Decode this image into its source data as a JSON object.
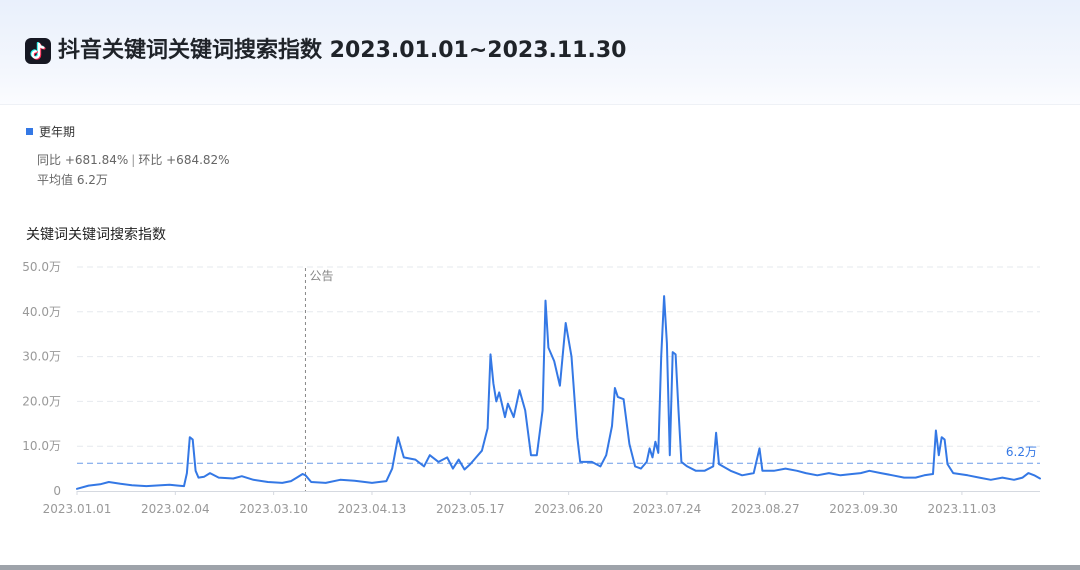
{
  "header": {
    "title": "抖音关键词关键词搜索指数 2023.01.01~2023.11.30",
    "logo_icon": "tiktok-logo-icon"
  },
  "legend": {
    "label": "更年期",
    "color": "#3478e5"
  },
  "stats": {
    "yoy": "同比 +681.84%",
    "separator": "|",
    "mom": "环比 +684.82%",
    "average": "平均值 6.2万"
  },
  "chart_data": {
    "type": "line",
    "title": "关键词关键词搜索指数",
    "xlabel": "",
    "ylabel": "",
    "ylim": [
      0,
      50
    ],
    "yunit": "万",
    "y_ticks": [
      "0",
      "10.0万",
      "20.0万",
      "30.0万",
      "40.0万",
      "50.0万"
    ],
    "x_ticks": [
      "2023.01.01",
      "2023.02.04",
      "2023.03.10",
      "2023.04.13",
      "2023.05.17",
      "2023.06.20",
      "2023.07.24",
      "2023.08.27",
      "2023.09.30",
      "2023.11.03"
    ],
    "x_range": [
      "2023.01.01",
      "2023.11.30"
    ],
    "grid": true,
    "average_line": {
      "value": 6.2,
      "label": "6.2万"
    },
    "annotation": {
      "date": "2023.03.21",
      "label": "公告"
    },
    "series": [
      {
        "name": "更年期",
        "color": "#3478e5",
        "points": [
          [
            "2023.01.01",
            0.5
          ],
          [
            "2023.01.05",
            1.2
          ],
          [
            "2023.01.09",
            1.5
          ],
          [
            "2023.01.12",
            2.0
          ],
          [
            "2023.01.16",
            1.6
          ],
          [
            "2023.01.20",
            1.3
          ],
          [
            "2023.01.25",
            1.1
          ],
          [
            "2023.01.30",
            1.3
          ],
          [
            "2023.02.02",
            1.4
          ],
          [
            "2023.02.05",
            1.2
          ],
          [
            "2023.02.07",
            1.1
          ],
          [
            "2023.02.08",
            4.0
          ],
          [
            "2023.02.09",
            12.0
          ],
          [
            "2023.02.10",
            11.5
          ],
          [
            "2023.02.11",
            4.5
          ],
          [
            "2023.02.12",
            3.0
          ],
          [
            "2023.02.14",
            3.2
          ],
          [
            "2023.02.16",
            4.0
          ],
          [
            "2023.02.19",
            3.0
          ],
          [
            "2023.02.24",
            2.8
          ],
          [
            "2023.02.27",
            3.3
          ],
          [
            "2023.03.03",
            2.5
          ],
          [
            "2023.03.08",
            2.0
          ],
          [
            "2023.03.13",
            1.8
          ],
          [
            "2023.03.16",
            2.2
          ],
          [
            "2023.03.18",
            3.0
          ],
          [
            "2023.03.20",
            3.8
          ],
          [
            "2023.03.21",
            3.5
          ],
          [
            "2023.03.23",
            2.0
          ],
          [
            "2023.03.28",
            1.8
          ],
          [
            "2023.04.02",
            2.5
          ],
          [
            "2023.04.07",
            2.3
          ],
          [
            "2023.04.13",
            1.8
          ],
          [
            "2023.04.18",
            2.2
          ],
          [
            "2023.04.20",
            5.0
          ],
          [
            "2023.04.22",
            12.0
          ],
          [
            "2023.04.24",
            7.5
          ],
          [
            "2023.04.28",
            7.0
          ],
          [
            "2023.05.01",
            5.5
          ],
          [
            "2023.05.03",
            8.0
          ],
          [
            "2023.05.06",
            6.5
          ],
          [
            "2023.05.09",
            7.5
          ],
          [
            "2023.05.11",
            5.0
          ],
          [
            "2023.05.13",
            7.0
          ],
          [
            "2023.05.15",
            4.8
          ],
          [
            "2023.05.17",
            6.0
          ],
          [
            "2023.05.19",
            7.5
          ],
          [
            "2023.05.21",
            9.0
          ],
          [
            "2023.05.23",
            14.0
          ],
          [
            "2023.05.24",
            30.5
          ],
          [
            "2023.05.25",
            24.0
          ],
          [
            "2023.05.26",
            20.0
          ],
          [
            "2023.05.27",
            22.0
          ],
          [
            "2023.05.29",
            16.5
          ],
          [
            "2023.05.30",
            19.5
          ],
          [
            "2023.06.01",
            16.5
          ],
          [
            "2023.06.03",
            22.5
          ],
          [
            "2023.06.05",
            18.0
          ],
          [
            "2023.06.07",
            8.0
          ],
          [
            "2023.06.09",
            8.0
          ],
          [
            "2023.06.11",
            18.0
          ],
          [
            "2023.06.12",
            42.5
          ],
          [
            "2023.06.13",
            32.0
          ],
          [
            "2023.06.15",
            29.0
          ],
          [
            "2023.06.17",
            23.5
          ],
          [
            "2023.06.19",
            37.5
          ],
          [
            "2023.06.21",
            30.0
          ],
          [
            "2023.06.23",
            12.0
          ],
          [
            "2023.06.24",
            6.5
          ],
          [
            "2023.06.28",
            6.5
          ],
          [
            "2023.07.01",
            5.5
          ],
          [
            "2023.07.03",
            8.0
          ],
          [
            "2023.07.05",
            14.5
          ],
          [
            "2023.07.06",
            23.0
          ],
          [
            "2023.07.07",
            21.0
          ],
          [
            "2023.07.09",
            20.5
          ],
          [
            "2023.07.11",
            10.5
          ],
          [
            "2023.07.13",
            5.5
          ],
          [
            "2023.07.15",
            5.0
          ],
          [
            "2023.07.17",
            6.5
          ],
          [
            "2023.07.18",
            9.5
          ],
          [
            "2023.07.19",
            7.5
          ],
          [
            "2023.07.20",
            11.0
          ],
          [
            "2023.07.21",
            8.5
          ],
          [
            "2023.07.22",
            30.0
          ],
          [
            "2023.07.23",
            43.5
          ],
          [
            "2023.07.24",
            33.0
          ],
          [
            "2023.07.25",
            8.0
          ],
          [
            "2023.07.26",
            31.0
          ],
          [
            "2023.07.27",
            30.5
          ],
          [
            "2023.07.28",
            18.0
          ],
          [
            "2023.07.29",
            6.5
          ],
          [
            "2023.07.31",
            5.5
          ],
          [
            "2023.08.03",
            4.5
          ],
          [
            "2023.08.06",
            4.5
          ],
          [
            "2023.08.09",
            5.5
          ],
          [
            "2023.08.10",
            13.0
          ],
          [
            "2023.08.11",
            6.0
          ],
          [
            "2023.08.15",
            4.5
          ],
          [
            "2023.08.19",
            3.5
          ],
          [
            "2023.08.23",
            4.0
          ],
          [
            "2023.08.25",
            9.5
          ],
          [
            "2023.08.26",
            4.5
          ],
          [
            "2023.08.30",
            4.5
          ],
          [
            "2023.09.03",
            5.0
          ],
          [
            "2023.09.07",
            4.5
          ],
          [
            "2023.09.10",
            4.0
          ],
          [
            "2023.09.14",
            3.5
          ],
          [
            "2023.09.18",
            4.0
          ],
          [
            "2023.09.22",
            3.5
          ],
          [
            "2023.09.26",
            3.8
          ],
          [
            "2023.09.29",
            4.0
          ],
          [
            "2023.10.02",
            4.5
          ],
          [
            "2023.10.06",
            4.0
          ],
          [
            "2023.10.10",
            3.5
          ],
          [
            "2023.10.14",
            3.0
          ],
          [
            "2023.10.18",
            3.0
          ],
          [
            "2023.10.21",
            3.5
          ],
          [
            "2023.10.24",
            3.8
          ],
          [
            "2023.10.25",
            13.5
          ],
          [
            "2023.10.26",
            8.0
          ],
          [
            "2023.10.27",
            12.0
          ],
          [
            "2023.10.28",
            11.5
          ],
          [
            "2023.10.29",
            6.0
          ],
          [
            "2023.10.31",
            4.0
          ],
          [
            "2023.11.05",
            3.5
          ],
          [
            "2023.11.09",
            3.0
          ],
          [
            "2023.11.13",
            2.5
          ],
          [
            "2023.11.17",
            3.0
          ],
          [
            "2023.11.21",
            2.5
          ],
          [
            "2023.11.24",
            3.0
          ],
          [
            "2023.11.26",
            4.0
          ],
          [
            "2023.11.28",
            3.5
          ],
          [
            "2023.11.30",
            2.8
          ]
        ]
      }
    ]
  }
}
